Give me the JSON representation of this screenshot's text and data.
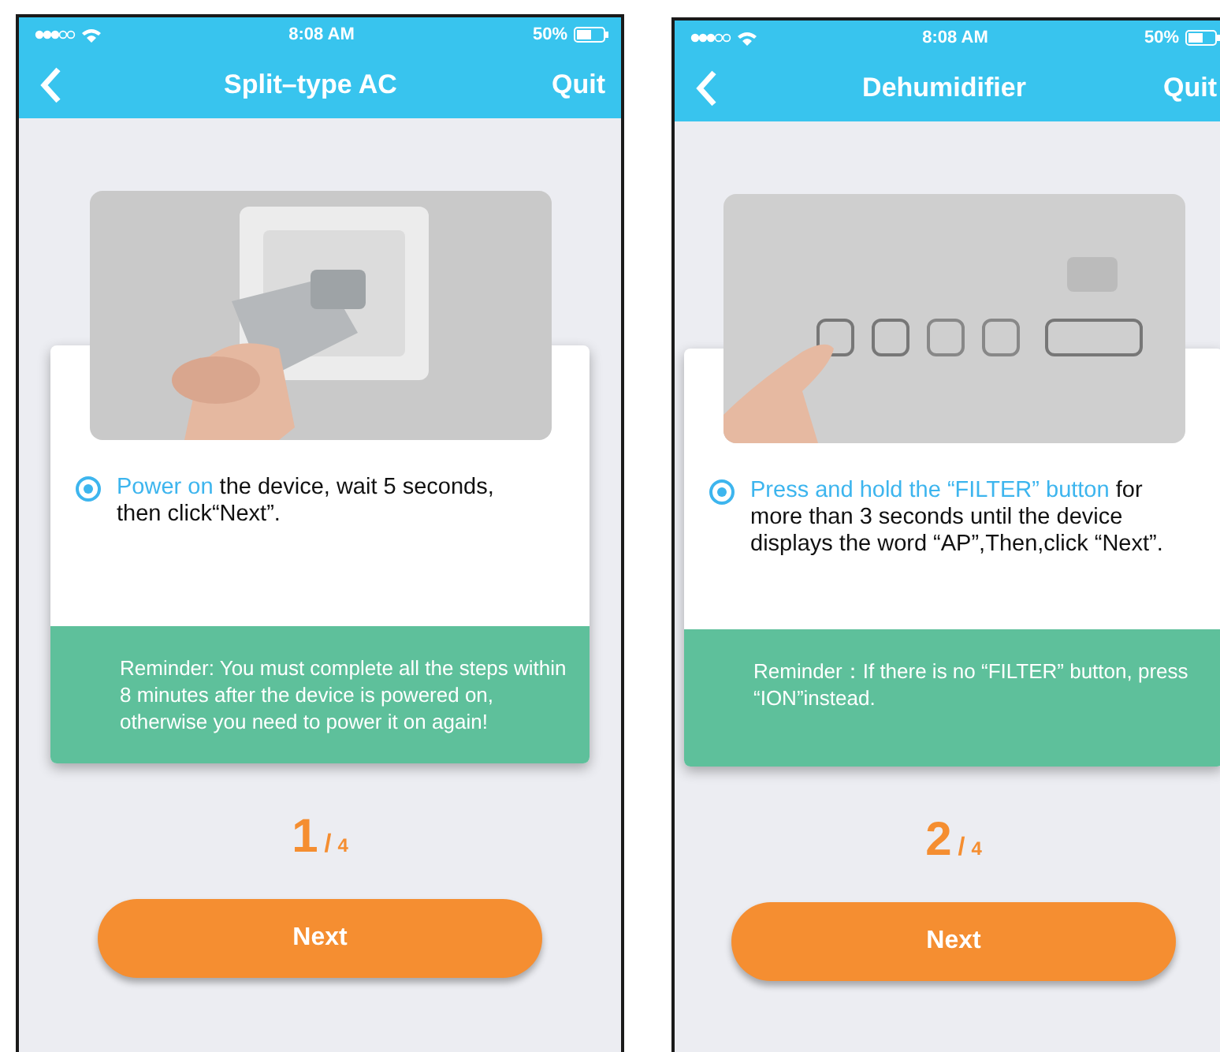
{
  "screens": [
    {
      "status_bar": {
        "time": "8:08 AM",
        "battery": "50%"
      },
      "nav": {
        "title": "Split–type AC",
        "quit": "Quit"
      },
      "step": {
        "selected": true,
        "highlight": "Power on",
        "rest": " the device, wait 5 seconds, then click“Next”."
      },
      "reminder": "Reminder: You must complete all the steps within 8 minutes after the device is powered on, otherwise you need to power it on again!",
      "counter": {
        "current": "1",
        "separator": "/",
        "total": "4"
      },
      "button": "Next"
    },
    {
      "status_bar": {
        "time": "8:08 AM",
        "battery": "50%"
      },
      "nav": {
        "title": "Dehumidifier",
        "quit": "Quit"
      },
      "step": {
        "selected": true,
        "highlight": "Press and hold the “FILTER” button",
        "rest": " for more than 3 seconds until the device displays the word “AP”,Then,click “Next”."
      },
      "reminder": "Reminder：If there is no “FILTER” button, press “ION”instead.",
      "counter": {
        "current": "2",
        "separator": "/",
        "total": "4"
      },
      "button": "Next"
    }
  ]
}
